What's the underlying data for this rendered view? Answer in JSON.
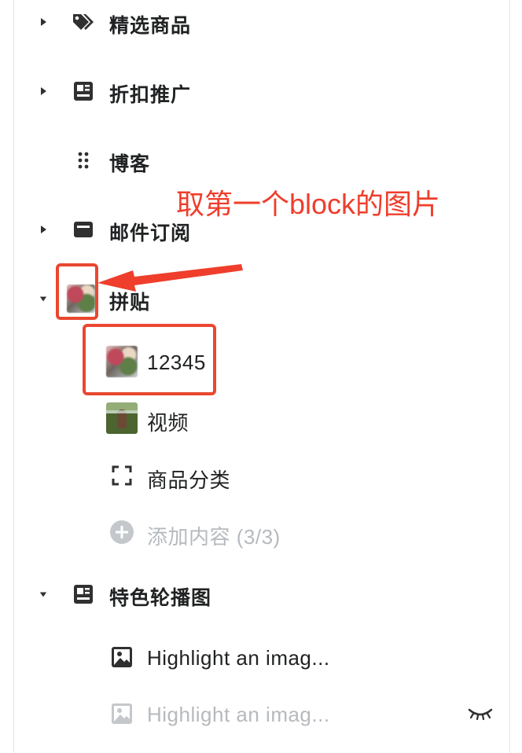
{
  "menu": {
    "items": [
      {
        "label": "精选商品",
        "icon": "tags-icon",
        "expanded": false
      },
      {
        "label": "折扣推广",
        "icon": "layout-icon",
        "expanded": false
      },
      {
        "label": "博客",
        "icon": "drag-dots-icon",
        "expanded": null
      },
      {
        "label": "邮件订阅",
        "icon": "mail-icon",
        "expanded": false
      },
      {
        "label": "拼贴",
        "icon": "collage-thumbnail",
        "expanded": true,
        "children": [
          {
            "label": "12345",
            "icon": "blurred-image-thumbnail"
          },
          {
            "label": "视频",
            "icon": "video-thumbnail"
          },
          {
            "label": "商品分类",
            "icon": "dashed-square-icon"
          },
          {
            "label": "添加内容 (3/3)",
            "icon": "plus-circle-icon",
            "muted": true
          }
        ]
      },
      {
        "label": "特色轮播图",
        "icon": "layout-icon",
        "expanded": true,
        "children": [
          {
            "label": "Highlight an imag...",
            "icon": "image-icon"
          },
          {
            "label": "Highlight an imag...",
            "icon": "image-icon",
            "muted": true,
            "hidden_icon": "eye-closed-icon"
          }
        ]
      }
    ]
  },
  "annotation": {
    "text": "取第一个block的图片",
    "color": "#ef3e2c"
  }
}
